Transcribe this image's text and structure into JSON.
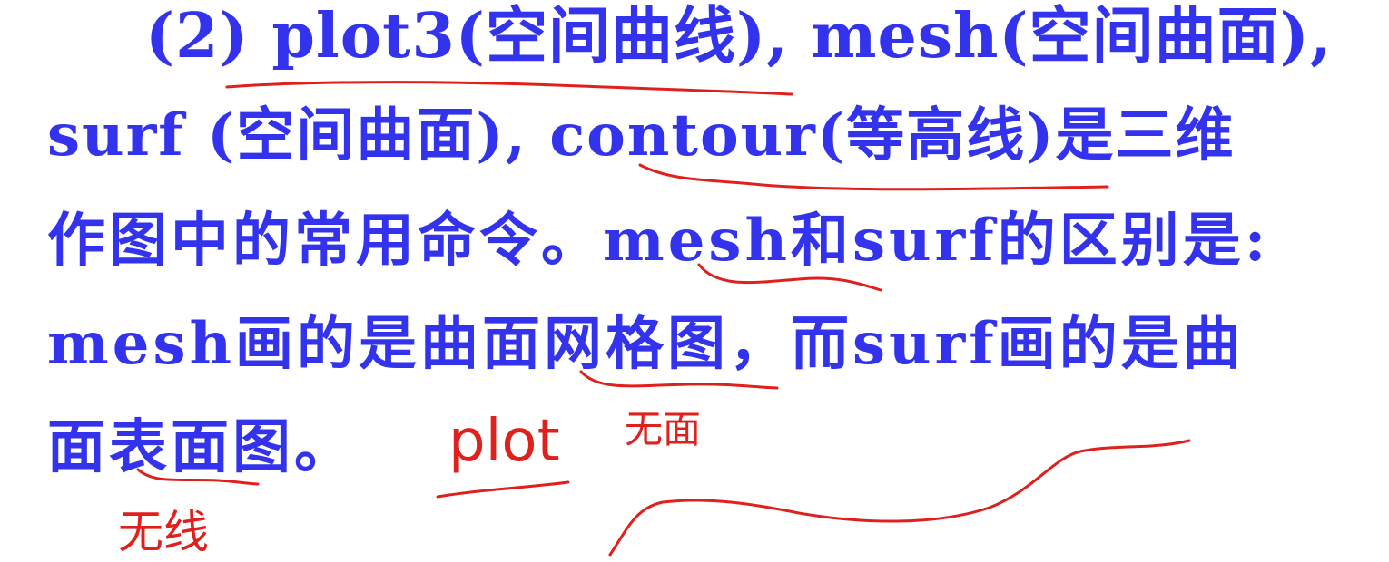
{
  "text": {
    "line1": "(2) plot3(空间曲线), mesh(空间曲面),",
    "line2": "surf (空间曲面), contour(等高线)是三维",
    "line3": "作图中的常用命令。mesh和surf的区别是:",
    "line4": "mesh画的是曲面网格图，而surf画的是曲",
    "line5": "面表面图。"
  },
  "annotations": {
    "under_line5": "无线",
    "under_line4": "无面",
    "plot_note": "plot"
  },
  "colors": {
    "text": "#3333ee",
    "ink": "#e0201c",
    "background": "#ffffff"
  }
}
